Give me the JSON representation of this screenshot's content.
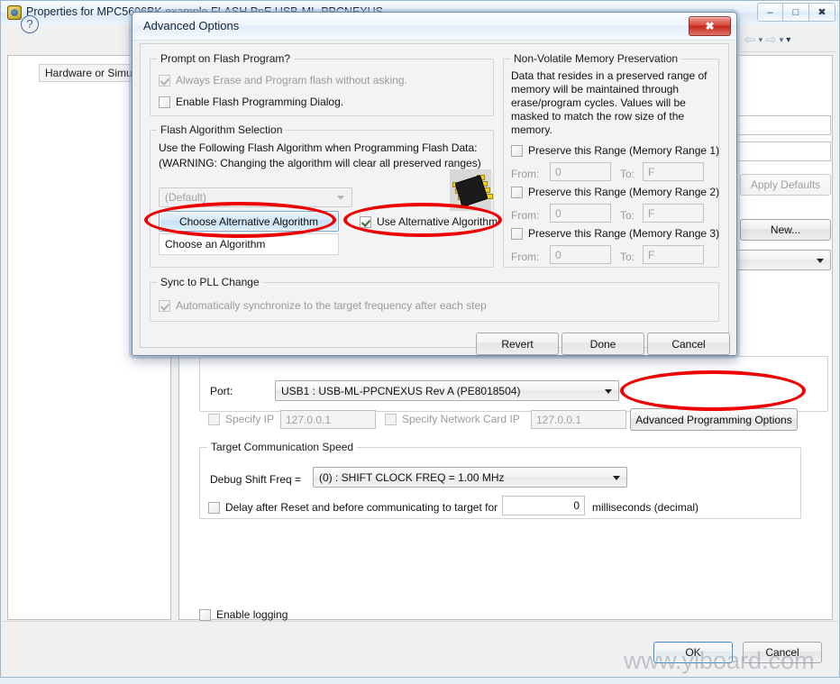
{
  "background_window": {
    "title": "Properties for MPC5606BK example FLASH PnE USB-ML-PPCNEXUS",
    "icon": "properties-window-icon",
    "window_buttons": {
      "minimize": "–",
      "maximize": "□",
      "close": "✖"
    },
    "toolbar": {
      "back": "⇦",
      "back_caret": "▾",
      "forward": "⇨",
      "forward_caret": "▾",
      "menu_caret": "▾"
    },
    "tree": {
      "selected_item": "Hardware or Simulat"
    },
    "right_controls": {
      "apply_defaults_label": "Apply Defaults",
      "new_label": "New...",
      "combo_value": ""
    },
    "connection": {
      "port_label": "Port:",
      "port_value": "USB1 : USB-ML-PPCNEXUS Rev A (PE8018504)",
      "specify_ip_label": "Specify IP",
      "specify_ip_value": "127.0.0.1",
      "specify_network_card_ip_label": "Specify Network Card IP",
      "specify_network_card_ip_value": "127.0.0.1",
      "advanced_programming_options_label": "Advanced Programming Options"
    },
    "target_speed": {
      "group_label": "Target Communication Speed",
      "debug_shift_freq_label": "Debug Shift Freq =",
      "debug_shift_freq_value": "(0) : SHIFT CLOCK FREQ = 1.00 MHz",
      "delay_label": "Delay after Reset and before communicating to target for",
      "delay_value": "0",
      "delay_units": "milliseconds (decimal)"
    },
    "enable_logging_label": "Enable logging",
    "footer": {
      "help_glyph": "?",
      "ok_label": "OK",
      "cancel_label": "Cancel"
    }
  },
  "dialog": {
    "title": "Advanced Options",
    "close_glyph": "✖",
    "prompt_group": {
      "label": "Prompt on Flash Program?",
      "always_erase_label": "Always Erase and Program flash without asking.",
      "always_erase_checked": true,
      "always_erase_enabled": false,
      "enable_dialog_label": "Enable Flash Programming Dialog.",
      "enable_dialog_checked": false
    },
    "algorithm_group": {
      "label": "Flash Algorithm Selection",
      "description_line1": "Use the Following Flash Algorithm when Programming Flash Data:",
      "description_line2": "(WARNING: Changing the algorithm will clear all preserved ranges)",
      "combo_value": "(Default)",
      "choose_alternative_button": "Choose Alternative Algorithm",
      "use_alternative_label": "Use Alternative Algorithm",
      "use_alternative_checked": true,
      "list_row_label": "Choose an Algorithm",
      "chip_icon": "ic-chip-icon"
    },
    "nvm_group": {
      "label": "Non-Volatile Memory Preservation",
      "description": "Data that resides in a preserved range of memory will be maintained through erase/program cycles. Values will be masked to match the row size of the memory.",
      "from_label": "From:",
      "to_label": "To:",
      "ranges": [
        {
          "label": "Preserve this Range (Memory Range 1)",
          "checked": false,
          "from": "0",
          "to": "F"
        },
        {
          "label": "Preserve this Range (Memory Range 2)",
          "checked": false,
          "from": "0",
          "to": "F"
        },
        {
          "label": "Preserve this Range (Memory Range 3)",
          "checked": false,
          "from": "0",
          "to": "F"
        }
      ]
    },
    "pll_group": {
      "label": "Sync to PLL Change",
      "auto_sync_label": "Automatically synchronize to the target frequency after each step",
      "auto_sync_checked": true,
      "auto_sync_enabled": false
    },
    "buttons": {
      "revert": "Revert",
      "done": "Done",
      "cancel": "Cancel"
    }
  },
  "annotations": {
    "highlight_color": "#ef0000",
    "watermark": "www.yiboard.com"
  }
}
